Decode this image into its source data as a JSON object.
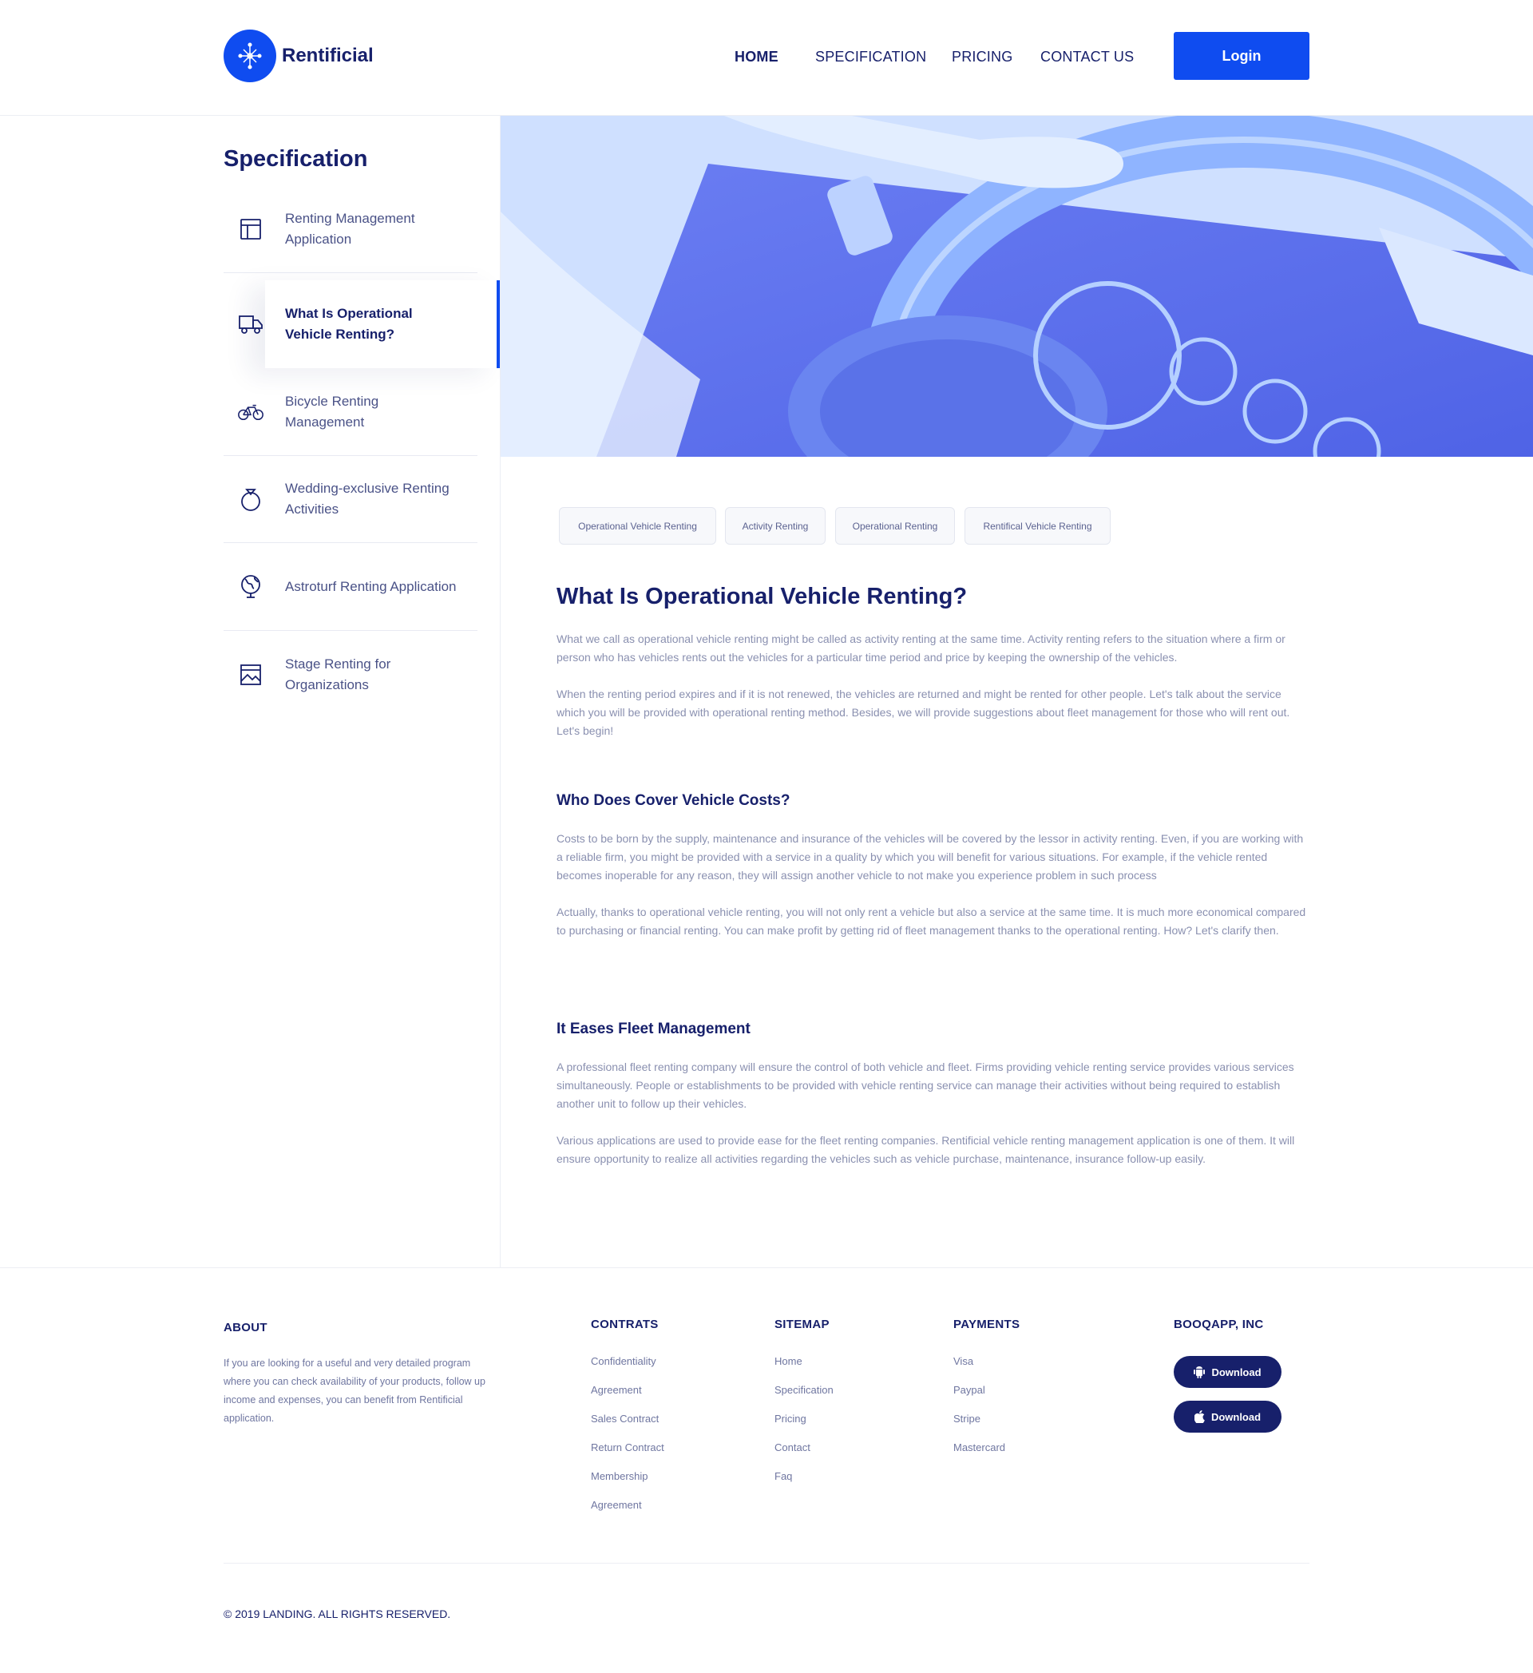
{
  "brand": {
    "name": "Rentificial"
  },
  "nav": {
    "home": "HOME",
    "specification": "SPECIFICATION",
    "pricing": "PRICING",
    "contact": "CONTACT US",
    "login": "Login"
  },
  "sidebar": {
    "title": "Specification",
    "items": [
      {
        "label": "Renting Management Application",
        "icon": "layout-icon"
      },
      {
        "label": "What Is Operational Vehicle Renting?",
        "icon": "truck-icon"
      },
      {
        "label": "Bicycle Renting Management",
        "icon": "bicycle-icon"
      },
      {
        "label": "Wedding-exclusive Renting Activities",
        "icon": "ring-icon"
      },
      {
        "label": "Astroturf Renting Application",
        "icon": "globe-icon"
      },
      {
        "label": "Stage Renting for Organizations",
        "icon": "picture-icon"
      }
    ]
  },
  "tags": [
    "Operational Vehicle Renting",
    "Activity Renting",
    "Operational Renting",
    "Rentifical Vehicle Renting"
  ],
  "article": {
    "title": "What Is Operational Vehicle Renting?",
    "p1": "What we call as operational vehicle renting might be called as activity renting at the same time. Activity renting refers to the situation where a firm or person who has vehicles rents out the vehicles for a particular time period and price by keeping the ownership of the vehicles.",
    "p2": "When the renting period expires and if it is not renewed, the vehicles are returned and might be rented for other people. Let's talk about the service which you will be provided with operational renting method. Besides, we will provide suggestions about fleet management for those who will rent out. Let's begin!",
    "h2a": "Who Does Cover Vehicle Costs?",
    "p3": "Costs to be born by the supply, maintenance and insurance of the vehicles will be covered by the lessor in activity renting. Even, if you are working with a reliable firm, you might be provided with a service in a quality by which you will benefit for various situations. For example, if the vehicle rented becomes inoperable for any reason, they will assign another vehicle to not make you experience problem in such process",
    "p4": "Actually, thanks to operational vehicle renting, you will not only rent a vehicle but also a service at the same time. It is much more economical compared to purchasing or financial renting. You can make profit by getting rid of fleet management thanks to the operational renting. How? Let's clarify then.",
    "h2b": "It Eases Fleet Management",
    "p5": "A professional fleet renting company will ensure the control of both vehicle and fleet. Firms providing vehicle renting service provides various services simultaneously. People or establishments to be provided with vehicle renting service can manage their activities without being required to establish another unit to follow up their vehicles.",
    "p6": "Various applications are used to provide ease for the fleet renting companies. Rentificial vehicle renting management application is one of them. It will ensure opportunity to realize all activities regarding the vehicles such as vehicle purchase, maintenance, insurance follow-up easily."
  },
  "footer": {
    "about_head": "ABOUT",
    "about_text": "If you are looking for a useful and very detailed program where you can check availability of your products, follow up income and expenses, you can benefit from Rentificial application.",
    "contracts_head": "CONTRATS",
    "contracts": [
      "Confidentiality",
      "Agreement",
      "Sales Contract",
      "Return Contract",
      "Membership",
      "Agreement"
    ],
    "sitemap_head": "SITEMAP",
    "sitemap": [
      "Home",
      "Specification",
      "Pricing",
      "Contact",
      "Faq"
    ],
    "payments_head": "PAYMENTS",
    "payments": [
      "Visa",
      "Paypal",
      "Stripe",
      "Mastercard"
    ],
    "company_head": "BOOQAPP, INC",
    "download_android": "Download",
    "download_ios": "Download",
    "copyright": "© 2019 LANDING. ALL RIGHTS RESERVED."
  },
  "colors": {
    "primary": "#0f4cf0",
    "navy": "#17206b",
    "muted": "#8a90b0"
  }
}
